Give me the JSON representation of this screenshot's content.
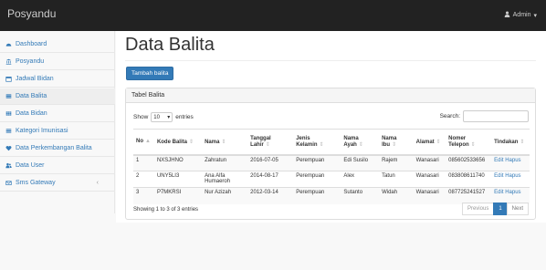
{
  "navbar": {
    "brand": "Posyandu",
    "user_label": "Admin"
  },
  "sidebar": {
    "items": [
      {
        "label": "Dashboard",
        "icon": "dashboard-icon"
      },
      {
        "label": "Posyandu",
        "icon": "institution-icon"
      },
      {
        "label": "Jadwal Bidan",
        "icon": "calendar-icon"
      },
      {
        "label": "Data Balita",
        "icon": "table-icon"
      },
      {
        "label": "Data Bidan",
        "icon": "table-grid-icon"
      },
      {
        "label": "Kategori Imunisasi",
        "icon": "list-icon"
      },
      {
        "label": "Data Perkembangan Balita",
        "icon": "heart-icon"
      },
      {
        "label": "Data User",
        "icon": "users-icon"
      },
      {
        "label": "Sms Gateway",
        "icon": "envelope-icon"
      }
    ]
  },
  "main": {
    "title": "Data Balita",
    "add_button": "Tambah balita",
    "panel_title": "Tabel Balita",
    "show_label": "Show",
    "show_value": "10",
    "entries_label": "entries",
    "search_label": "Search:",
    "columns": [
      "No",
      "Kode Balita",
      "Nama",
      "Tanggal Lahir",
      "Jenis Kelamin",
      "Nama Ayah",
      "Nama Ibu",
      "Alamat",
      "Nomer Telepon",
      "Tindakan"
    ],
    "rows": [
      [
        "1",
        "NXSJHNO",
        "Zahratun",
        "2016-07-05",
        "Perempuan",
        "Edi Susilo",
        "Rajem",
        "Wanasari",
        "085602533656"
      ],
      [
        "2",
        "UNY5LI3",
        "Ana Alfa Humaeroh",
        "2014-08-17",
        "Perempuan",
        "Alex",
        "Tatun",
        "Wanasari",
        "083808611740"
      ],
      [
        "3",
        "P7MKRSI",
        "Nur Azizah",
        "2012-03-14",
        "Perempuan",
        "Sutanto",
        "Widah",
        "Wanasari",
        "087725241527"
      ]
    ],
    "action_edit": "Edit",
    "action_delete": "Hapus",
    "info": "Showing 1 to 3 of 3 entries",
    "pager": {
      "prev": "Previous",
      "page": "1",
      "next": "Next"
    }
  },
  "colors": {
    "navbar": "#222222",
    "link": "#337ab7",
    "primary": "#337ab7"
  }
}
